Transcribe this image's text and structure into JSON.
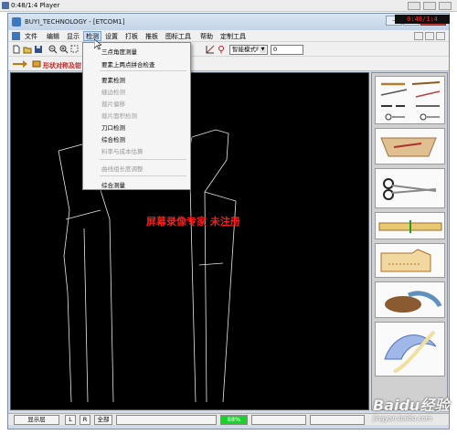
{
  "player": {
    "title": "0:48/1:4 Player",
    "timer": "0:48/1:4"
  },
  "window": {
    "title": "BUYI_TECHNOLOGY - [ETCOM1]"
  },
  "menu": {
    "items": [
      "文件",
      "编辑",
      "显示",
      "检测",
      "设置",
      "打板",
      "推板",
      "图标工具",
      "帮助",
      "定制工具"
    ]
  },
  "toolbar": {
    "mode_combo": "智能模式F5",
    "value_input": "0",
    "tool_hint": "形状对称及钳"
  },
  "dropdown": {
    "items": [
      {
        "label": "三点角度测量",
        "enabled": true
      },
      {
        "label": "要素上两点拼合检查",
        "enabled": true
      },
      {
        "label": "要素检测",
        "enabled": true
      },
      {
        "label": "缝边检测",
        "enabled": false
      },
      {
        "label": "裁片偏移",
        "enabled": false
      },
      {
        "label": "裁片面积检测",
        "enabled": false
      },
      {
        "label": "刀口检测",
        "enabled": true
      },
      {
        "label": "综合检测",
        "enabled": true
      },
      {
        "label": "料率与成本估算",
        "enabled": false
      },
      {
        "label": "曲线组长度调整",
        "enabled": false
      },
      {
        "label": "综合测量",
        "enabled": true
      }
    ]
  },
  "watermark": "屏幕录像专家  未注册",
  "statusbar": {
    "layer": "显示层",
    "L": "L",
    "R": "R",
    "all": "全部",
    "green_value": "88%"
  },
  "site": {
    "logo": "Baidu经验",
    "url": "jingyan.baidu.com"
  },
  "colors": {
    "menu_highlight": "#cde0f6",
    "watermark": "#ff1a1a",
    "status_green": "#18d42a",
    "canvas": "#000000"
  }
}
